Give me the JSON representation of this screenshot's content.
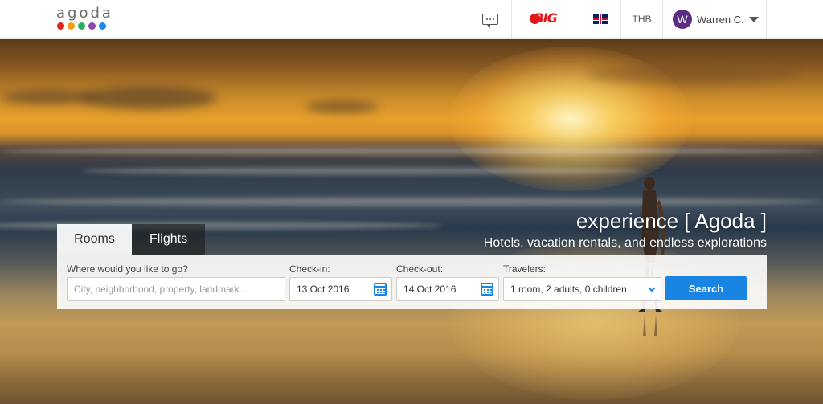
{
  "header": {
    "logo_text": "agoda",
    "logo_dot_colors": [
      "#e2231a",
      "#f39c12",
      "#27ae60",
      "#8e44ad",
      "#1e88e5"
    ],
    "messages_icon": "chat-icon",
    "rewards_label": "BIG",
    "language_icon": "uk-flag-icon",
    "currency": "THB",
    "user": {
      "avatar_initial": "W",
      "name": "Warren C."
    }
  },
  "hero": {
    "tagline": "experience [ Agoda ]",
    "subtagline": "Hotels, vacation rentals, and endless explorations"
  },
  "tabs": [
    {
      "label": "Rooms",
      "active": true
    },
    {
      "label": "Flights",
      "active": false
    }
  ],
  "search": {
    "destination": {
      "label": "Where would you like to go?",
      "placeholder": "City, neighborhood, property, landmark..."
    },
    "checkin": {
      "label": "Check-in:",
      "value": "13 Oct 2016"
    },
    "checkout": {
      "label": "Check-out:",
      "value": "14 Oct 2016"
    },
    "travelers": {
      "label": "Travelers:",
      "value": "1 room, 2 adults, 0 children"
    },
    "button_label": "Search"
  },
  "colors": {
    "accent": "#1a84e2",
    "avatar_bg": "#5a2d82",
    "rewards_red": "#e3161b"
  }
}
